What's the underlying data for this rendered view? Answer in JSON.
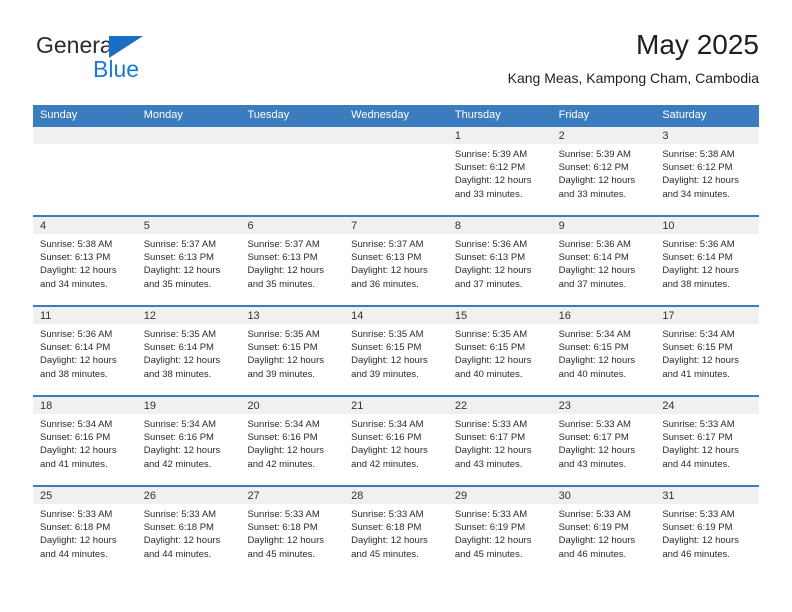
{
  "brand": {
    "name_top": "General",
    "name_bottom": "Blue",
    "triangle_color": "#1a6fc4",
    "blue_color": "#1a7ad4"
  },
  "header": {
    "title": "May 2025",
    "subtitle": "Kang Meas, Kampong Cham, Cambodia"
  },
  "theme": {
    "header_blue": "#3b7cbf",
    "day_band_gray": "#f0f0f0",
    "text_color": "#2b2b2b"
  },
  "weekdays": [
    "Sunday",
    "Monday",
    "Tuesday",
    "Wednesday",
    "Thursday",
    "Friday",
    "Saturday"
  ],
  "weeks": [
    [
      {
        "day": "",
        "empty": true
      },
      {
        "day": "",
        "empty": true
      },
      {
        "day": "",
        "empty": true
      },
      {
        "day": "",
        "empty": true
      },
      {
        "day": "1",
        "sunrise": "Sunrise: 5:39 AM",
        "sunset": "Sunset: 6:12 PM",
        "daylight1": "Daylight: 12 hours",
        "daylight2": "and 33 minutes."
      },
      {
        "day": "2",
        "sunrise": "Sunrise: 5:39 AM",
        "sunset": "Sunset: 6:12 PM",
        "daylight1": "Daylight: 12 hours",
        "daylight2": "and 33 minutes."
      },
      {
        "day": "3",
        "sunrise": "Sunrise: 5:38 AM",
        "sunset": "Sunset: 6:12 PM",
        "daylight1": "Daylight: 12 hours",
        "daylight2": "and 34 minutes."
      }
    ],
    [
      {
        "day": "4",
        "sunrise": "Sunrise: 5:38 AM",
        "sunset": "Sunset: 6:13 PM",
        "daylight1": "Daylight: 12 hours",
        "daylight2": "and 34 minutes."
      },
      {
        "day": "5",
        "sunrise": "Sunrise: 5:37 AM",
        "sunset": "Sunset: 6:13 PM",
        "daylight1": "Daylight: 12 hours",
        "daylight2": "and 35 minutes."
      },
      {
        "day": "6",
        "sunrise": "Sunrise: 5:37 AM",
        "sunset": "Sunset: 6:13 PM",
        "daylight1": "Daylight: 12 hours",
        "daylight2": "and 35 minutes."
      },
      {
        "day": "7",
        "sunrise": "Sunrise: 5:37 AM",
        "sunset": "Sunset: 6:13 PM",
        "daylight1": "Daylight: 12 hours",
        "daylight2": "and 36 minutes."
      },
      {
        "day": "8",
        "sunrise": "Sunrise: 5:36 AM",
        "sunset": "Sunset: 6:13 PM",
        "daylight1": "Daylight: 12 hours",
        "daylight2": "and 37 minutes."
      },
      {
        "day": "9",
        "sunrise": "Sunrise: 5:36 AM",
        "sunset": "Sunset: 6:14 PM",
        "daylight1": "Daylight: 12 hours",
        "daylight2": "and 37 minutes."
      },
      {
        "day": "10",
        "sunrise": "Sunrise: 5:36 AM",
        "sunset": "Sunset: 6:14 PM",
        "daylight1": "Daylight: 12 hours",
        "daylight2": "and 38 minutes."
      }
    ],
    [
      {
        "day": "11",
        "sunrise": "Sunrise: 5:36 AM",
        "sunset": "Sunset: 6:14 PM",
        "daylight1": "Daylight: 12 hours",
        "daylight2": "and 38 minutes."
      },
      {
        "day": "12",
        "sunrise": "Sunrise: 5:35 AM",
        "sunset": "Sunset: 6:14 PM",
        "daylight1": "Daylight: 12 hours",
        "daylight2": "and 38 minutes."
      },
      {
        "day": "13",
        "sunrise": "Sunrise: 5:35 AM",
        "sunset": "Sunset: 6:15 PM",
        "daylight1": "Daylight: 12 hours",
        "daylight2": "and 39 minutes."
      },
      {
        "day": "14",
        "sunrise": "Sunrise: 5:35 AM",
        "sunset": "Sunset: 6:15 PM",
        "daylight1": "Daylight: 12 hours",
        "daylight2": "and 39 minutes."
      },
      {
        "day": "15",
        "sunrise": "Sunrise: 5:35 AM",
        "sunset": "Sunset: 6:15 PM",
        "daylight1": "Daylight: 12 hours",
        "daylight2": "and 40 minutes."
      },
      {
        "day": "16",
        "sunrise": "Sunrise: 5:34 AM",
        "sunset": "Sunset: 6:15 PM",
        "daylight1": "Daylight: 12 hours",
        "daylight2": "and 40 minutes."
      },
      {
        "day": "17",
        "sunrise": "Sunrise: 5:34 AM",
        "sunset": "Sunset: 6:15 PM",
        "daylight1": "Daylight: 12 hours",
        "daylight2": "and 41 minutes."
      }
    ],
    [
      {
        "day": "18",
        "sunrise": "Sunrise: 5:34 AM",
        "sunset": "Sunset: 6:16 PM",
        "daylight1": "Daylight: 12 hours",
        "daylight2": "and 41 minutes."
      },
      {
        "day": "19",
        "sunrise": "Sunrise: 5:34 AM",
        "sunset": "Sunset: 6:16 PM",
        "daylight1": "Daylight: 12 hours",
        "daylight2": "and 42 minutes."
      },
      {
        "day": "20",
        "sunrise": "Sunrise: 5:34 AM",
        "sunset": "Sunset: 6:16 PM",
        "daylight1": "Daylight: 12 hours",
        "daylight2": "and 42 minutes."
      },
      {
        "day": "21",
        "sunrise": "Sunrise: 5:34 AM",
        "sunset": "Sunset: 6:16 PM",
        "daylight1": "Daylight: 12 hours",
        "daylight2": "and 42 minutes."
      },
      {
        "day": "22",
        "sunrise": "Sunrise: 5:33 AM",
        "sunset": "Sunset: 6:17 PM",
        "daylight1": "Daylight: 12 hours",
        "daylight2": "and 43 minutes."
      },
      {
        "day": "23",
        "sunrise": "Sunrise: 5:33 AM",
        "sunset": "Sunset: 6:17 PM",
        "daylight1": "Daylight: 12 hours",
        "daylight2": "and 43 minutes."
      },
      {
        "day": "24",
        "sunrise": "Sunrise: 5:33 AM",
        "sunset": "Sunset: 6:17 PM",
        "daylight1": "Daylight: 12 hours",
        "daylight2": "and 44 minutes."
      }
    ],
    [
      {
        "day": "25",
        "sunrise": "Sunrise: 5:33 AM",
        "sunset": "Sunset: 6:18 PM",
        "daylight1": "Daylight: 12 hours",
        "daylight2": "and 44 minutes."
      },
      {
        "day": "26",
        "sunrise": "Sunrise: 5:33 AM",
        "sunset": "Sunset: 6:18 PM",
        "daylight1": "Daylight: 12 hours",
        "daylight2": "and 44 minutes."
      },
      {
        "day": "27",
        "sunrise": "Sunrise: 5:33 AM",
        "sunset": "Sunset: 6:18 PM",
        "daylight1": "Daylight: 12 hours",
        "daylight2": "and 45 minutes."
      },
      {
        "day": "28",
        "sunrise": "Sunrise: 5:33 AM",
        "sunset": "Sunset: 6:18 PM",
        "daylight1": "Daylight: 12 hours",
        "daylight2": "and 45 minutes."
      },
      {
        "day": "29",
        "sunrise": "Sunrise: 5:33 AM",
        "sunset": "Sunset: 6:19 PM",
        "daylight1": "Daylight: 12 hours",
        "daylight2": "and 45 minutes."
      },
      {
        "day": "30",
        "sunrise": "Sunrise: 5:33 AM",
        "sunset": "Sunset: 6:19 PM",
        "daylight1": "Daylight: 12 hours",
        "daylight2": "and 46 minutes."
      },
      {
        "day": "31",
        "sunrise": "Sunrise: 5:33 AM",
        "sunset": "Sunset: 6:19 PM",
        "daylight1": "Daylight: 12 hours",
        "daylight2": "and 46 minutes."
      }
    ]
  ]
}
